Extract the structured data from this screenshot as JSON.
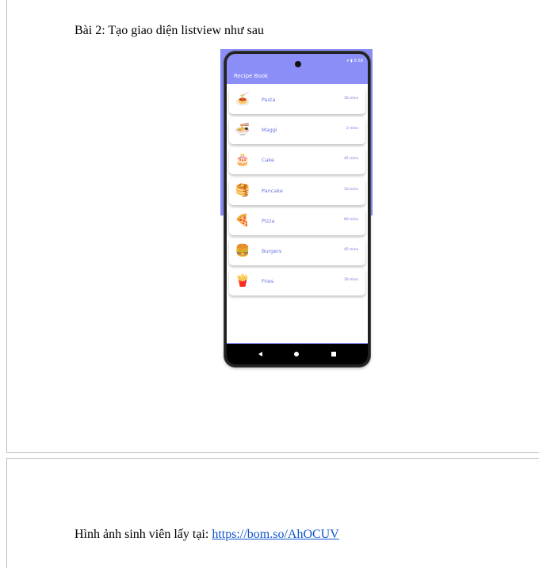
{
  "heading": "Bài 2: Tạo giao diện listview như sau",
  "phone": {
    "status_time": "6:58",
    "app_title": "Recipe Book",
    "recipes": [
      {
        "name": "Pasta",
        "time": "30 mins",
        "icon": "pasta-icon",
        "glyph": "🍝"
      },
      {
        "name": "Maggi",
        "time": "2 mins",
        "icon": "maggi-icon",
        "glyph": "🍜"
      },
      {
        "name": "Cake",
        "time": "45 mins",
        "icon": "cake-icon",
        "glyph": "🎂"
      },
      {
        "name": "Pancake",
        "time": "10 mins",
        "icon": "pancake-icon",
        "glyph": "🥞"
      },
      {
        "name": "Pizza",
        "time": "60 mins",
        "icon": "pizza-icon",
        "glyph": "🍕"
      },
      {
        "name": "Burgers",
        "time": "45 mins",
        "icon": "burger-icon",
        "glyph": "🍔"
      },
      {
        "name": "Fries",
        "time": "30 mins",
        "icon": "fries-icon",
        "glyph": "🍟"
      }
    ],
    "accent_color": "#8b8ef6",
    "text_color": "#6b73e0"
  },
  "source": {
    "prefix": "Hình ảnh sinh viên lấy tại: ",
    "link_text": "https://bom.so/AhOCUV"
  }
}
